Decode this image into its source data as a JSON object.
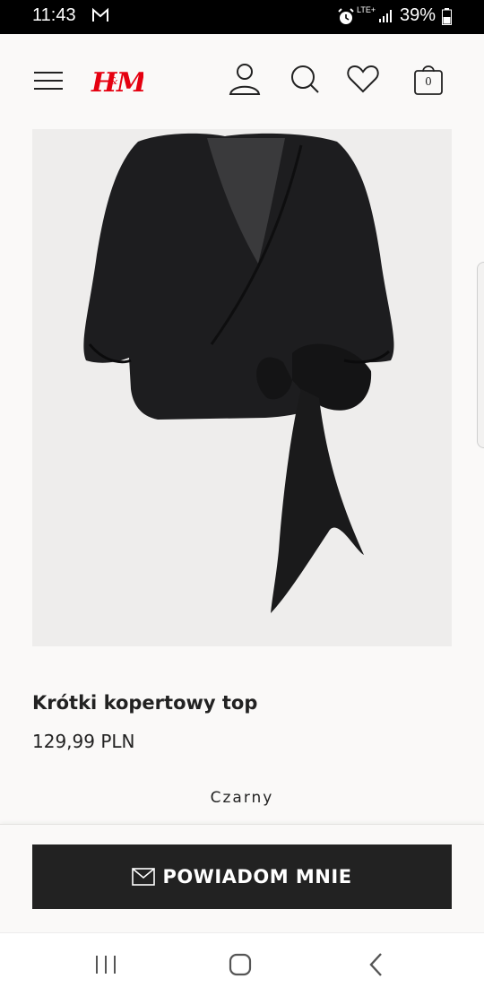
{
  "status_bar": {
    "time": "11:43",
    "network": "LTE+",
    "battery": "39%",
    "icons": [
      "gmail-icon",
      "alarm-icon",
      "signal-icon",
      "battery-icon"
    ]
  },
  "header": {
    "logo": "H&M",
    "brand_color": "#e50010",
    "cart_count": "0",
    "icons": [
      "menu-icon",
      "account-icon",
      "search-icon",
      "heart-icon",
      "bag-icon"
    ]
  },
  "product": {
    "name": "Krótki kopertowy top",
    "price": "129,99 PLN",
    "color": "Czarny"
  },
  "actions": {
    "notify_label": "POWIADOM MNIE"
  },
  "nav_bar": {
    "icons": [
      "recent-apps-icon",
      "home-icon",
      "back-icon"
    ]
  }
}
